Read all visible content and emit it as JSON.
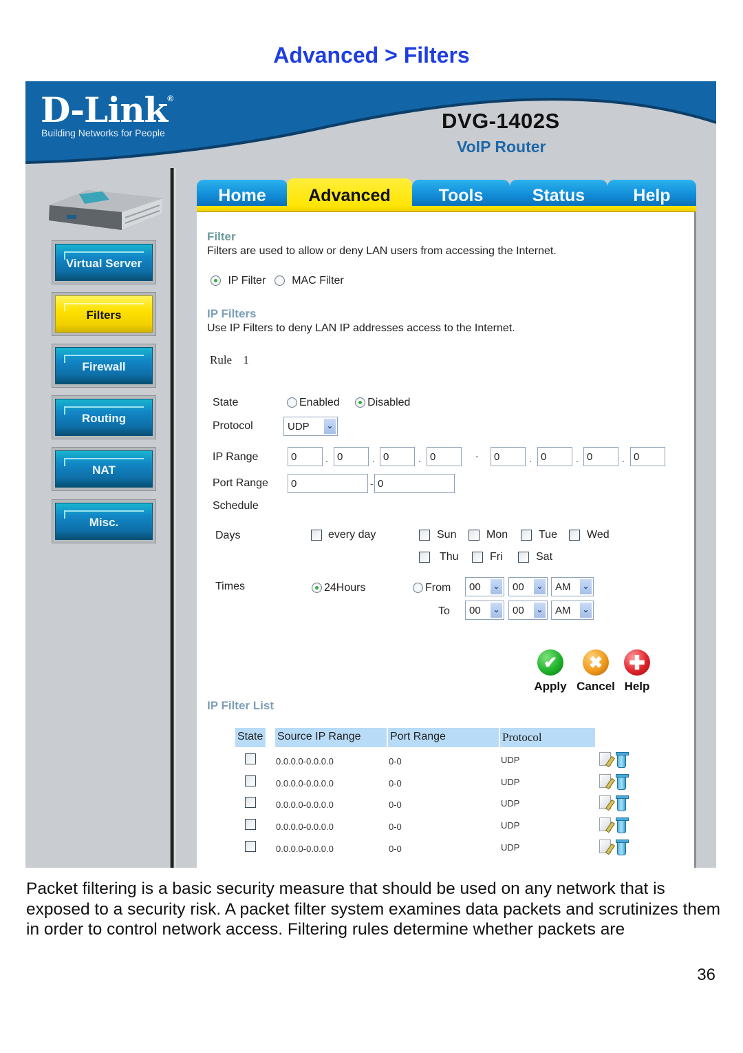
{
  "page_heading": "Advanced > Filters",
  "header": {
    "brand": "D-Link",
    "brand_mark": "®",
    "tagline": "Building Networks for People",
    "model": "DVG-1402S",
    "model_sub": "VoIP Router"
  },
  "sidebar": {
    "device_image": "router-device-image",
    "items": [
      {
        "label": "Virtual Server",
        "active": false
      },
      {
        "label": "Filters",
        "active": true
      },
      {
        "label": "Firewall",
        "active": false
      },
      {
        "label": "Routing",
        "active": false
      },
      {
        "label": "NAT",
        "active": false
      },
      {
        "label": "Misc.",
        "active": false
      }
    ]
  },
  "tabs": [
    {
      "label": "Home",
      "active": false
    },
    {
      "label": "Advanced",
      "active": true
    },
    {
      "label": "Tools",
      "active": false
    },
    {
      "label": "Status",
      "active": false
    },
    {
      "label": "Help",
      "active": false
    }
  ],
  "filter": {
    "title": "Filter",
    "description": "Filters are used to allow or deny LAN users from accessing the Internet.",
    "type_options": [
      {
        "label": "IP Filter",
        "selected": true
      },
      {
        "label": "MAC Filter",
        "selected": false
      }
    ]
  },
  "ip_filters": {
    "title": "IP Filters",
    "description": "Use IP Filters to deny LAN IP addresses access to the Internet.",
    "rule_label": "Rule",
    "rule_number": "1",
    "state": {
      "label": "State",
      "options": [
        {
          "label": "Enabled",
          "selected": false
        },
        {
          "label": "Disabled",
          "selected": true
        }
      ]
    },
    "protocol": {
      "label": "Protocol",
      "value": "UDP"
    },
    "ip_range": {
      "label": "IP Range",
      "start": [
        "0",
        "0",
        "0",
        "0"
      ],
      "end": [
        "0",
        "0",
        "0",
        "0"
      ],
      "separator": "-",
      "dot": "."
    },
    "port_range": {
      "label": "Port Range",
      "start": "0",
      "end": "0",
      "separator": "-"
    },
    "schedule_label": "Schedule",
    "days": {
      "label": "Days",
      "every_day": {
        "label": "every day",
        "checked": false
      },
      "week": [
        {
          "label": "Sun",
          "checked": false
        },
        {
          "label": "Mon",
          "checked": false
        },
        {
          "label": "Tue",
          "checked": false
        },
        {
          "label": "Wed",
          "checked": false
        },
        {
          "label": "Thu",
          "checked": false
        },
        {
          "label": "Fri",
          "checked": false
        },
        {
          "label": "Sat",
          "checked": false
        }
      ]
    },
    "times": {
      "label": "Times",
      "all_day": {
        "label": "24Hours",
        "selected": true
      },
      "from": {
        "label": "From",
        "selected": false,
        "hour": "00",
        "minute": "00",
        "ampm": "AM"
      },
      "to": {
        "label": "To",
        "hour": "00",
        "minute": "00",
        "ampm": "AM"
      }
    }
  },
  "actions": {
    "apply": {
      "label": "Apply",
      "icon": "check-icon"
    },
    "cancel": {
      "label": "Cancel",
      "icon": "x-icon"
    },
    "help": {
      "label": "Help",
      "icon": "plus-icon"
    }
  },
  "filter_list": {
    "title": "IP Filter List",
    "columns": [
      "State",
      "Source IP Range",
      "Port Range",
      "Protocol"
    ],
    "rows": [
      {
        "checked": false,
        "source_ip": "0.0.0.0-0.0.0.0",
        "port_range": "0-0",
        "protocol": "UDP"
      },
      {
        "checked": false,
        "source_ip": "0.0.0.0-0.0.0.0",
        "port_range": "0-0",
        "protocol": "UDP"
      },
      {
        "checked": false,
        "source_ip": "0.0.0.0-0.0.0.0",
        "port_range": "0-0",
        "protocol": "UDP"
      },
      {
        "checked": false,
        "source_ip": "0.0.0.0-0.0.0.0",
        "port_range": "0-0",
        "protocol": "UDP"
      },
      {
        "checked": false,
        "source_ip": "0.0.0.0-0.0.0.0",
        "port_range": "0-0",
        "protocol": "UDP"
      }
    ]
  },
  "body_text": "Packet filtering is a basic security measure that should be used on any network that is exposed to a security risk. A packet filter system examines data packets and scrutinizes them in order to control network access. Filtering rules determine whether packets are",
  "page_number": "36",
  "colors": {
    "heading_blue": "#1f3ee0",
    "header_blue": "#1266a8",
    "tab_blue": "#128dd8",
    "active_yellow": "#ffe400",
    "section_title": "#7d9fb8",
    "list_header_bg": "#b8dbf7"
  }
}
